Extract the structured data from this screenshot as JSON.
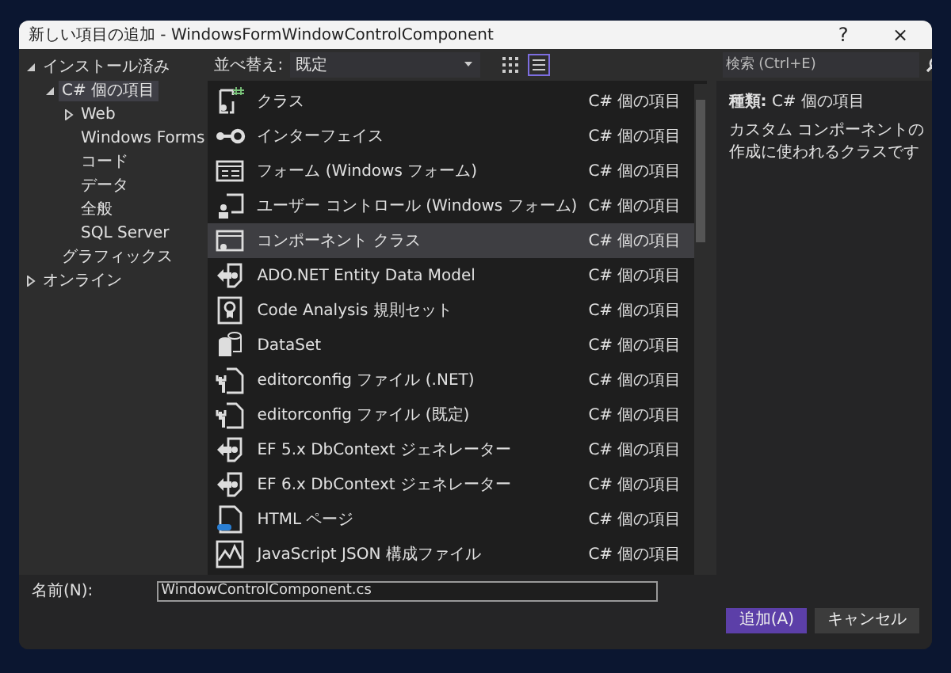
{
  "window": {
    "title": "新しい項目の追加 - WindowsFormWindowControlComponent",
    "help": "?",
    "close": "×"
  },
  "tree": [
    {
      "label": "インストール済み",
      "expanded": true,
      "selected": false,
      "children": [
        {
          "label": "C# 個の項目",
          "expanded": true,
          "selected": true,
          "children": [
            {
              "label": "Web",
              "expanded": false,
              "selected": false
            },
            {
              "label": "Windows Forms",
              "selected": false
            },
            {
              "label": "コード",
              "selected": false
            },
            {
              "label": "データ",
              "selected": false
            },
            {
              "label": "全般",
              "selected": false
            },
            {
              "label": "SQL Server",
              "selected": false
            }
          ]
        },
        {
          "label": "グラフィックス",
          "selected": false
        }
      ]
    },
    {
      "label": "オンライン",
      "expanded": false,
      "selected": false
    }
  ],
  "toolbar": {
    "sort_label": "並べ替え:",
    "sort_value": "既定",
    "views": [
      {
        "kind": "grid",
        "selected": false
      },
      {
        "kind": "list",
        "selected": true
      }
    ]
  },
  "search": {
    "placeholder": "検索 (Ctrl+E)"
  },
  "templates": [
    {
      "kind": "class",
      "name": "クラス",
      "category": "C# 個の項目",
      "selected": false
    },
    {
      "kind": "interface",
      "name": "インターフェイス",
      "category": "C# 個の項目",
      "selected": false
    },
    {
      "kind": "form",
      "name": "フォーム (Windows フォーム)",
      "category": "C# 個の項目",
      "selected": false
    },
    {
      "kind": "usercontrol",
      "name": "ユーザー コントロール (Windows フォーム)",
      "category": "C# 個の項目",
      "selected": false
    },
    {
      "kind": "component",
      "name": "コンポーネント クラス",
      "category": "C# 個の項目",
      "selected": true
    },
    {
      "kind": "generator",
      "name": "ADO.NET Entity Data Model",
      "category": "C# 個の項目",
      "selected": false
    },
    {
      "kind": "ruleset",
      "name": "Code Analysis 規則セット",
      "category": "C# 個の項目",
      "selected": false
    },
    {
      "kind": "dataset",
      "name": "DataSet",
      "category": "C# 個の項目",
      "selected": false
    },
    {
      "kind": "config",
      "name": "editorconfig ファイル (.NET)",
      "category": "C# 個の項目",
      "selected": false
    },
    {
      "kind": "config",
      "name": "editorconfig ファイル (既定)",
      "category": "C# 個の項目",
      "selected": false
    },
    {
      "kind": "generator",
      "name": "EF 5.x DbContext ジェネレーター",
      "category": "C# 個の項目",
      "selected": false
    },
    {
      "kind": "generator",
      "name": "EF 6.x DbContext ジェネレーター",
      "category": "C# 個の項目",
      "selected": false
    },
    {
      "kind": "html",
      "name": "HTML ページ",
      "category": "C# 個の項目",
      "selected": false
    },
    {
      "kind": "json",
      "name": "JavaScript JSON 構成ファイル",
      "category": "C# 個の項目",
      "selected": false
    }
  ],
  "details": {
    "type_label": "種類:",
    "type_value": "C# 個の項目",
    "description": "カスタム コンポーネントの作成に使われるクラスです"
  },
  "name_field": {
    "label": "名前(N):",
    "value": "WindowControlComponent.cs"
  },
  "buttons": [
    {
      "kind": "primary",
      "label": "追加(A)"
    },
    {
      "kind": "secondary",
      "label": "キャンセル"
    }
  ]
}
